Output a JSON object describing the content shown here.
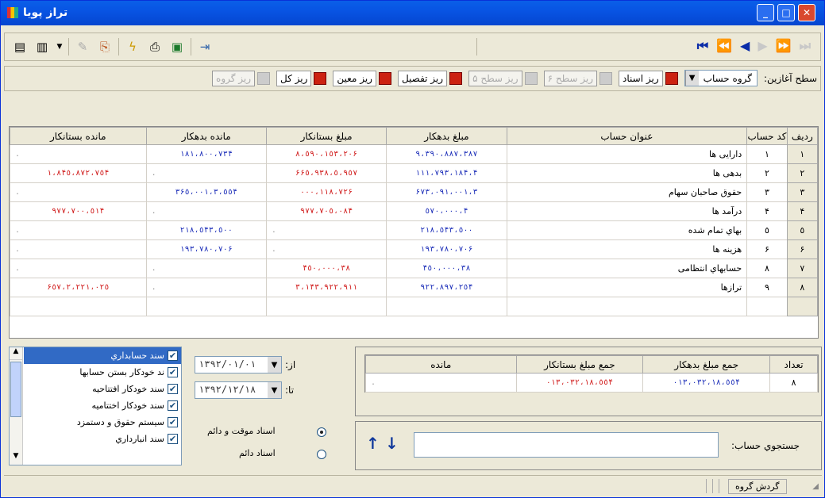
{
  "window": {
    "title": "تراز پویا"
  },
  "nav": [
    "⏮",
    "⏪",
    "◀",
    "▶",
    "⏩",
    "⏭"
  ],
  "toolbar3": {
    "start_level_label": ":سطح آغازین",
    "start_level_value": "گروه حساب",
    "items": [
      {
        "label": "ریز اسناد",
        "enabled": true
      },
      {
        "label": "ریز سطح ۶",
        "enabled": false
      },
      {
        "label": "ریز سطح ۵",
        "enabled": false
      },
      {
        "label": "ریز تفصیل",
        "enabled": true
      },
      {
        "label": "ریز معین",
        "enabled": true
      },
      {
        "label": "ریز کل",
        "enabled": true
      },
      {
        "label": "ریز گروه",
        "enabled": false
      }
    ]
  },
  "table": {
    "headers": [
      "ردیف",
      "کد حساب",
      "عنوان حساب",
      "مبلغ بدهکار",
      "مبلغ بستانکار",
      "مانده بدهکار",
      "مانده بستانکار"
    ],
    "rows": [
      [
        "١",
        "١",
        "دارایی ها",
        "٩،٣٩٠،٨٨٧،٣٨٧",
        "٨،٥٩٠،١٥٣،٢٠۶",
        "٨٠٠،٧٣۴،١٨١",
        "."
      ],
      [
        "٢",
        "٢",
        "بدهی ها",
        "۴،١١١،٧٩٣،١٨۴",
        "٥،٩٥٧،۶۶٥،٩٣٨",
        ".",
        "١،٨۴٥،٨٧٢،٧٥۴"
      ],
      [
        "٣",
        "٣",
        "حقوق صاحبان سهام",
        "٣،۶٧٣،٠٩١،٠٠١",
        "١١٨،٧٢۶،٠٠٠",
        "٣،٥٥۴،٣۶٥،٠٠١",
        "."
      ],
      [
        "۴",
        "۴",
        "درآمد ها",
        "۴،٥٧٠،٠٠٠",
        "٧٠٥،٠٨۴،٩٧٧",
        ".",
        "٧٠٠،٥١۴،٩٧٧"
      ],
      [
        "٥",
        "٥",
        "بهاي تمام شده",
        "٢١٨،٥۴٣،٥٠٠",
        ".",
        "٢١٨،٥۴٣،٥٠٠",
        "."
      ],
      [
        "۶",
        "۶",
        "هزينه ها",
        "١٩٣،٧٨٠،٧٠۶",
        ".",
        "١٩٣،٧٨٠،٧٠۶",
        "."
      ],
      [
        "٧",
        "٨",
        "حسابهاي انتظامی",
        "٣٨،۴٥٠،٠٠٠",
        "٣٨،۴٥٠،٠٠٠",
        ".",
        "."
      ],
      [
        "٨",
        "٩",
        "ترازها",
        "٩٢٢،٨٩٧،٢٥۴",
        "٣،١۴٣،٩٢٢،٩١١",
        ".",
        "٢،٢٢١،٠٢٥،۶٥٧"
      ]
    ]
  },
  "filters": {
    "list": [
      {
        "label": "سند حسابداري",
        "checked": true,
        "selected": true
      },
      {
        "label": "ند خودکار بستن حسابها",
        "checked": true
      },
      {
        "label": "سند خودکار افتتاحيه",
        "checked": true
      },
      {
        "label": "سند خودکار اختتاميه",
        "checked": true
      },
      {
        "label": "سيستم حقوق و دستمزد",
        "checked": true
      },
      {
        "label": "سند انبارداري",
        "checked": true
      }
    ],
    "from_label": ":از",
    "from_value": "١٣٩٢/٠١/٠١",
    "to_label": ":تا",
    "to_value": "١٣٩٢/١٢/١٨",
    "radio1": "اسناد موقت و دائم",
    "radio2": "اسناد دائم"
  },
  "summary": {
    "headers": [
      "تعداد",
      "جمع مبلغ بدهکار",
      "جمع مبلغ بستانکار",
      "مانده"
    ],
    "values": [
      "٨",
      "١٨،٥٥۴،٠١٣،٠٣٢",
      "١٨،٥٥۴،٠١٣،٠٣٢",
      "."
    ]
  },
  "search": {
    "label": ":جستجوي حساب"
  },
  "status": {
    "label": "گردش گروه"
  }
}
